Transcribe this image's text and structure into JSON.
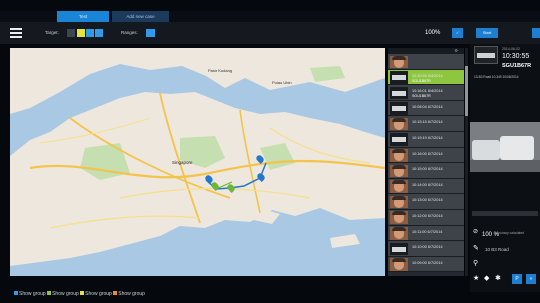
{
  "tabs": [
    {
      "label": "Test"
    },
    {
      "label": "Add new case"
    }
  ],
  "toolbar": {
    "target_label": "Target:",
    "target_box_label": "1",
    "plus_label": "+",
    "minus_label": "-",
    "ranges_label": "Ranges:",
    "zoom": "100%",
    "start_label": "Start",
    "colors": {
      "selected": "#8ec63f",
      "accent": "#1e7ed0",
      "chip_yellow": "#e5e43a"
    }
  },
  "map": {
    "labels": [
      {
        "text": "Pulau Ubin"
      },
      {
        "text": "Pasir Kudang"
      },
      {
        "text": "Singapore"
      }
    ]
  },
  "list": {
    "header_icon": "gear-icon",
    "rows": [
      {
        "thumb": "face",
        "time": "",
        "plate": "",
        "selected": false
      },
      {
        "thumb": "plate",
        "time": "10:30:55 6/4/2014",
        "plate": "SGU1B67R",
        "selected": true
      },
      {
        "thumb": "plate",
        "time": "10:16:01 6/4/2014",
        "plate": "SGU1B67R",
        "selected": false
      },
      {
        "thumb": "plate",
        "time": "10:08:04 6/7/2014",
        "plate": "",
        "selected": false
      },
      {
        "thumb": "face",
        "time": "10:15:15 6/7/2014",
        "plate": "",
        "selected": false
      },
      {
        "thumb": "plate",
        "time": "10:19:19 6/7/2014",
        "plate": "",
        "selected": false
      },
      {
        "thumb": "face",
        "time": "10:16:00 6/7/2014",
        "plate": "",
        "selected": false
      },
      {
        "thumb": "face",
        "time": "10:15:00 6/7/2014",
        "plate": "",
        "selected": false
      },
      {
        "thumb": "face",
        "time": "10:14:00 6/7/2014",
        "plate": "",
        "selected": false
      },
      {
        "thumb": "face",
        "time": "10:13:00 6/7/2014",
        "plate": "",
        "selected": false
      },
      {
        "thumb": "face",
        "time": "10:12:00 6/7/2014",
        "plate": "",
        "selected": false
      },
      {
        "thumb": "face",
        "time": "10:11:00 6/7/2014",
        "plate": "",
        "selected": false
      },
      {
        "thumb": "plate",
        "time": "10:10:00 6/7/2014",
        "plate": "",
        "selected": false
      },
      {
        "thumb": "face",
        "time": "10:09:00 6/7/2014",
        "plate": "",
        "selected": false
      }
    ]
  },
  "detail": {
    "date": "2014-06-02",
    "time": "10:30:55",
    "plate": "SGU1B67R",
    "road_info": "13-B3 Road  10,349  10/06/2014",
    "accuracy": "100 %",
    "accuracy_note": "accuracy calculated",
    "road": "10 B3 Road"
  },
  "legend": [
    {
      "label": "Show group",
      "color": "#2f9be8"
    },
    {
      "label": "Show group",
      "color": "#8ec63f"
    },
    {
      "label": "Show group",
      "color": "#e5e43a"
    },
    {
      "label": "Show group",
      "color": "#f08a2c"
    }
  ]
}
